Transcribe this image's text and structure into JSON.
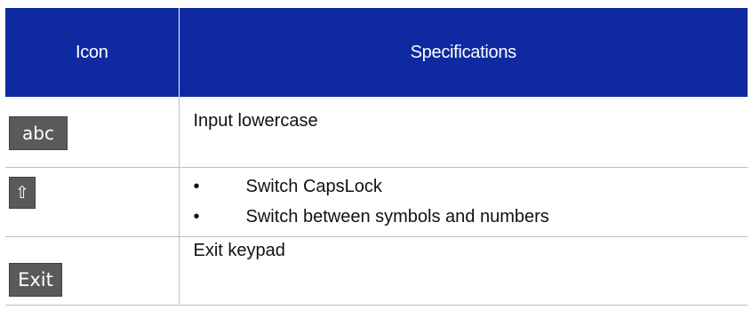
{
  "table": {
    "headers": {
      "icon": "Icon",
      "specifications": "Specifications"
    },
    "rows": [
      {
        "icon_label": "abc",
        "icon_name": "lowercase-key-icon",
        "specification": "Input lowercase"
      },
      {
        "icon_label": "⇧",
        "icon_name": "shift-arrow-icon",
        "bullet_symbol": "•",
        "bullets": [
          "Switch CapsLock",
          "Switch between symbols and numbers"
        ]
      },
      {
        "icon_label": "Exit",
        "icon_name": "exit-key-icon",
        "specification": "Exit keypad"
      }
    ]
  },
  "colors": {
    "header_bg": "#0f2aa0",
    "header_text": "#ffffff",
    "key_bg": "#5a5a5a",
    "border": "#bfbfbf"
  }
}
